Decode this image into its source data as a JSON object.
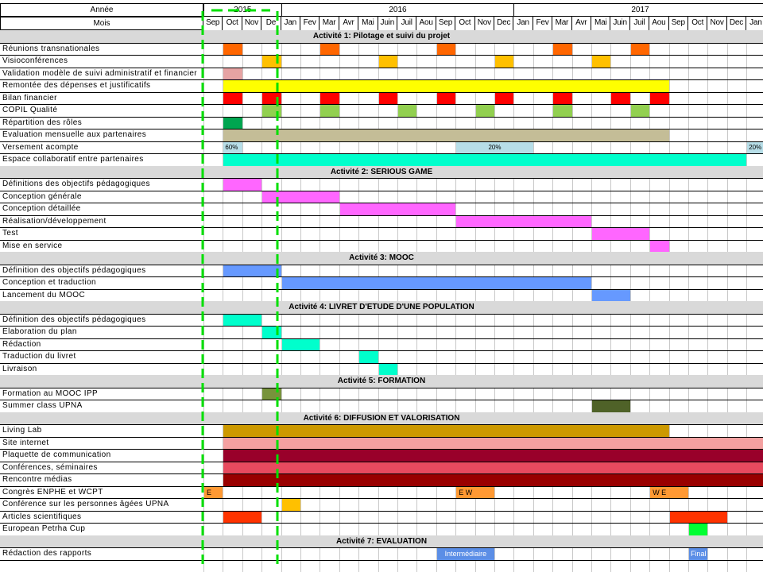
{
  "header": {
    "year_label": "Année",
    "month_label": "Mois",
    "years": [
      "2015",
      "2016",
      "2017"
    ],
    "months": [
      "Sep",
      "Oct",
      "Nov",
      "De",
      "Jan",
      "Fev",
      "Mar",
      "Avr",
      "Mai",
      "Juin",
      "Juil",
      "Aou",
      "Sep",
      "Oct",
      "Nov",
      "Dec",
      "Jan",
      "Fev",
      "Mar",
      "Avr",
      "Mai",
      "Juin",
      "Juil",
      "Aou",
      "Sep",
      "Oct",
      "Nov",
      "Dec",
      "Jan"
    ]
  },
  "colors": {
    "orange": "#ff6600",
    "amber": "#ffc000",
    "pink_light": "#e6a3a3",
    "yellow": "#ffff00",
    "red": "#ff0000",
    "lime": "#92d050",
    "green_dark": "#00a550",
    "khaki": "#c4bd97",
    "light_blue": "#b7dee8",
    "turquoise": "#00ffcc",
    "magenta": "#ff66ff",
    "blue": "#6699ff",
    "olive": "#77933c",
    "olive_dark": "#4f6228",
    "gold": "#cc9900",
    "salmon": "#f4a0a0",
    "crimson": "#99002a",
    "coral": "#e84a5f",
    "maroon": "#990000",
    "orange_light": "#ff9933",
    "orange_red": "#ff3300",
    "green_bright": "#00ff33",
    "steel_blue": "#5b8ee6",
    "section_gray": "#d9d9d9",
    "highlight_dash": "#00e000"
  },
  "sections": [
    {
      "title": "Activité 1: Pilotage et suivi du projet",
      "tasks": [
        {
          "label": "Réunions transnationales",
          "bars": [
            {
              "s": 1,
              "e": 2,
              "c": "orange"
            },
            {
              "s": 6,
              "e": 7,
              "c": "orange"
            },
            {
              "s": 12,
              "e": 13,
              "c": "orange"
            },
            {
              "s": 18,
              "e": 19,
              "c": "orange"
            },
            {
              "s": 22,
              "e": 23,
              "c": "orange"
            }
          ]
        },
        {
          "label": "Visioconférences",
          "bars": [
            {
              "s": 3,
              "e": 4,
              "c": "amber"
            },
            {
              "s": 9,
              "e": 10,
              "c": "amber"
            },
            {
              "s": 15,
              "e": 16,
              "c": "amber"
            },
            {
              "s": 20,
              "e": 21,
              "c": "amber"
            }
          ]
        },
        {
          "label": "Validation modèle de suivi administratif et financier",
          "bars": [
            {
              "s": 1,
              "e": 2,
              "c": "pink_light"
            }
          ]
        },
        {
          "label": "Remontée des dépenses et justificatifs",
          "bars": [
            {
              "s": 1,
              "e": 24,
              "c": "yellow"
            }
          ]
        },
        {
          "label": "Bilan financier",
          "bars": [
            {
              "s": 1,
              "e": 2,
              "c": "red"
            },
            {
              "s": 3,
              "e": 4,
              "c": "red"
            },
            {
              "s": 6,
              "e": 7,
              "c": "red"
            },
            {
              "s": 9,
              "e": 10,
              "c": "red"
            },
            {
              "s": 12,
              "e": 13,
              "c": "red"
            },
            {
              "s": 15,
              "e": 16,
              "c": "red"
            },
            {
              "s": 18,
              "e": 19,
              "c": "red"
            },
            {
              "s": 21,
              "e": 22,
              "c": "red"
            },
            {
              "s": 23,
              "e": 24,
              "c": "red"
            }
          ]
        },
        {
          "label": "COPIL Qualité",
          "bars": [
            {
              "s": 3,
              "e": 4,
              "c": "lime"
            },
            {
              "s": 6,
              "e": 7,
              "c": "lime"
            },
            {
              "s": 10,
              "e": 11,
              "c": "lime"
            },
            {
              "s": 14,
              "e": 15,
              "c": "lime"
            },
            {
              "s": 18,
              "e": 19,
              "c": "lime"
            },
            {
              "s": 22,
              "e": 23,
              "c": "lime"
            }
          ]
        },
        {
          "label": "Répartition des rôles",
          "bars": [
            {
              "s": 1,
              "e": 2,
              "c": "green_dark"
            }
          ]
        },
        {
          "label": "Evaluation mensuelle aux partenaires",
          "bars": [
            {
              "s": 1,
              "e": 24,
              "c": "khaki"
            }
          ]
        },
        {
          "label": "Versement acompte",
          "bars": [
            {
              "s": 1,
              "e": 2,
              "c": "light_blue",
              "text": "60%"
            },
            {
              "s": 13,
              "e": 17,
              "c": "light_blue",
              "text": "20%"
            },
            {
              "s": 28,
              "e": 29,
              "c": "light_blue",
              "text": "20%"
            }
          ]
        },
        {
          "label": "Espace collaboratif entre partenaires",
          "bars": [
            {
              "s": 1,
              "e": 28,
              "c": "turquoise"
            }
          ]
        }
      ]
    },
    {
      "title": "Activité 2: SERIOUS GAME",
      "tasks": [
        {
          "label": "Définitions des objectifs pédagogiques",
          "bars": [
            {
              "s": 1,
              "e": 3,
              "c": "magenta"
            }
          ]
        },
        {
          "label": "Conception générale",
          "bars": [
            {
              "s": 3,
              "e": 7,
              "c": "magenta"
            }
          ]
        },
        {
          "label": "Conception détaillée",
          "bars": [
            {
              "s": 7,
              "e": 13,
              "c": "magenta"
            }
          ]
        },
        {
          "label": "Réalisation/développement",
          "bars": [
            {
              "s": 13,
              "e": 20,
              "c": "magenta"
            }
          ]
        },
        {
          "label": "Test",
          "bars": [
            {
              "s": 20,
              "e": 23,
              "c": "magenta"
            }
          ]
        },
        {
          "label": "Mise en service",
          "bars": [
            {
              "s": 23,
              "e": 24,
              "c": "magenta"
            }
          ]
        }
      ]
    },
    {
      "title": "Activité 3: MOOC",
      "tasks": [
        {
          "label": "Définition des objectifs pédagogiques",
          "bars": [
            {
              "s": 1,
              "e": 4,
              "c": "blue"
            }
          ]
        },
        {
          "label": "Conception et traduction",
          "bars": [
            {
              "s": 4,
              "e": 20,
              "c": "blue"
            }
          ]
        },
        {
          "label": "Lancement du MOOC",
          "bars": [
            {
              "s": 20,
              "e": 22,
              "c": "blue"
            }
          ]
        }
      ]
    },
    {
      "title": "Activité 4: LIVRET D'ETUDE D'UNE POPULATION",
      "tasks": [
        {
          "label": "Définition des objectifs pédagogiques",
          "bars": [
            {
              "s": 1,
              "e": 3,
              "c": "turquoise"
            }
          ]
        },
        {
          "label": "Elaboration du plan",
          "bars": [
            {
              "s": 3,
              "e": 4,
              "c": "turquoise"
            }
          ]
        },
        {
          "label": "Rédaction",
          "bars": [
            {
              "s": 4,
              "e": 6,
              "c": "turquoise"
            }
          ]
        },
        {
          "label": "Traduction du livret",
          "bars": [
            {
              "s": 8,
              "e": 9,
              "c": "turquoise"
            }
          ]
        },
        {
          "label": "Livraison",
          "bars": [
            {
              "s": 9,
              "e": 10,
              "c": "turquoise"
            }
          ]
        }
      ]
    },
    {
      "title": "Activité 5: FORMATION",
      "tasks": [
        {
          "label": "Formation au MOOC IPP",
          "bars": [
            {
              "s": 3,
              "e": 4,
              "c": "olive"
            }
          ]
        },
        {
          "label": "Summer class UPNA",
          "bars": [
            {
              "s": 20,
              "e": 22,
              "c": "olive_dark"
            }
          ]
        }
      ]
    },
    {
      "title": "Activité 6: DIFFUSION ET VALORISATION",
      "tasks": [
        {
          "label": "Living  Lab",
          "bars": [
            {
              "s": 1,
              "e": 24,
              "c": "gold"
            }
          ]
        },
        {
          "label": "Site internet",
          "bars": [
            {
              "s": 1,
              "e": 29,
              "c": "salmon"
            }
          ]
        },
        {
          "label": "Plaquette de communication",
          "bars": [
            {
              "s": 1,
              "e": 29,
              "c": "crimson"
            }
          ]
        },
        {
          "label": "Conférences, séminaires",
          "bars": [
            {
              "s": 1,
              "e": 29,
              "c": "coral"
            }
          ]
        },
        {
          "label": "Rencontre médias",
          "bars": [
            {
              "s": 1,
              "e": 29,
              "c": "maroon"
            }
          ]
        },
        {
          "label": "Congrès ENPHE et WCPT",
          "bars": [
            {
              "s": 0,
              "e": 1,
              "c": "orange_light",
              "text": "E"
            },
            {
              "s": 13,
              "e": 15,
              "c": "orange_light",
              "text": "E     W"
            },
            {
              "s": 23,
              "e": 25,
              "c": "orange_light",
              "text": "W    E"
            }
          ]
        },
        {
          "label": "Conférence sur les personnes âgées UPNA",
          "bars": [
            {
              "s": 4,
              "e": 5,
              "c": "amber"
            }
          ]
        },
        {
          "label": "Articles scientifiques",
          "bars": [
            {
              "s": 1,
              "e": 3,
              "c": "orange_red"
            },
            {
              "s": 24,
              "e": 27,
              "c": "orange_red"
            }
          ]
        },
        {
          "label": "European Petrha Cup",
          "bars": [
            {
              "s": 25,
              "e": 26,
              "c": "green_bright"
            }
          ]
        }
      ]
    },
    {
      "title": "Activité 7: EVALUATION",
      "tasks": [
        {
          "label": "Rédaction des rapports",
          "bars": [
            {
              "s": 12,
              "e": 15,
              "c": "steel_blue",
              "text": "Intermédiaire"
            },
            {
              "s": 25,
              "e": 26,
              "c": "steel_blue",
              "text": "Final"
            }
          ]
        }
      ]
    }
  ]
}
